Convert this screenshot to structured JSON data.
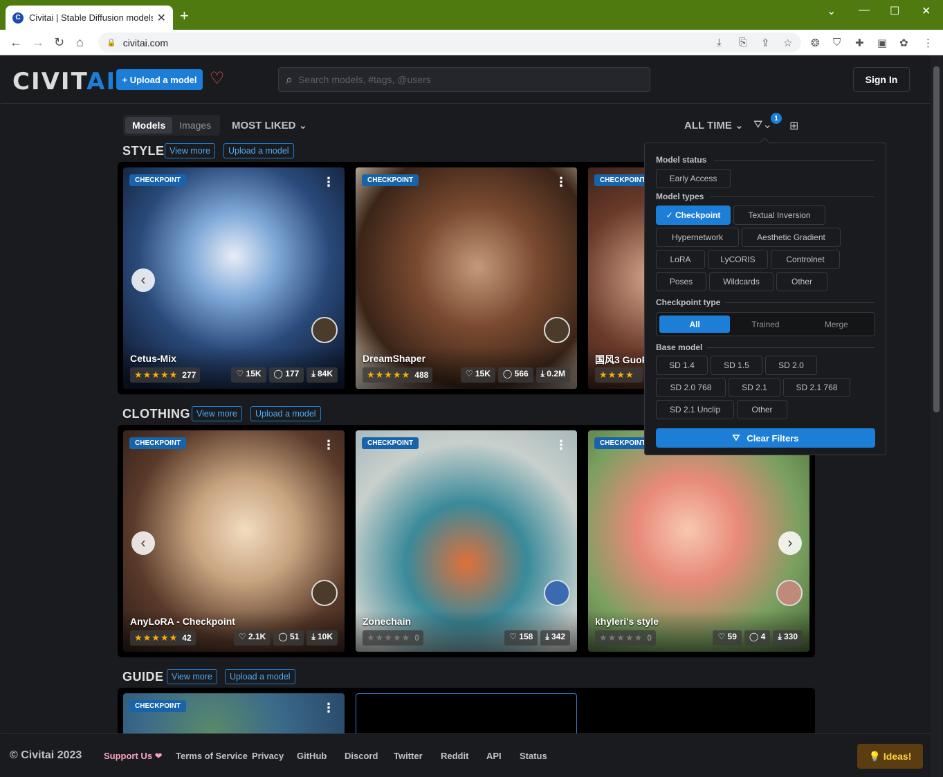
{
  "browser": {
    "tab_title": "Civitai | Stable Diffusion models",
    "url": "civitai.com",
    "favicon_letter": "C"
  },
  "header": {
    "logo_a": "CIVIT",
    "logo_b": "AI",
    "upload_label": "+ Upload a model",
    "search_placeholder": "Search models, #tags, @users",
    "signin_label": "Sign In"
  },
  "toolbar": {
    "tabs": [
      "Models",
      "Images"
    ],
    "active_tab": "Models",
    "sort_label": "MOST LIKED",
    "period_label": "ALL TIME",
    "filter_count": "1"
  },
  "sections": [
    {
      "title": "STYLE",
      "view_more": "View more",
      "upload": "Upload a model",
      "cards": [
        {
          "tag": "CHECKPOINT",
          "name": "Cetus-Mix",
          "stars": "★★★★★",
          "rating_count": "277",
          "likes": "♡ 15K",
          "comments": "◯ 177",
          "downloads": "⤓ 84K"
        },
        {
          "tag": "CHECKPOINT",
          "name": "DreamShaper",
          "stars": "★★★★★",
          "rating_count": "488",
          "likes": "♡ 15K",
          "comments": "◯ 566",
          "downloads": "⤓ 0.2M"
        },
        {
          "tag": "CHECKPOINT",
          "name": "国风3 GuoF",
          "stars": "★★★★",
          "rating_count": "",
          "likes": "",
          "comments": "",
          "downloads": ""
        }
      ]
    },
    {
      "title": "CLOTHING",
      "view_more": "View more",
      "upload": "Upload a model",
      "cards": [
        {
          "tag": "CHECKPOINT",
          "name": "AnyLoRA - Checkpoint",
          "stars": "★★★★★",
          "rating_count": "42",
          "likes": "♡ 2.1K",
          "comments": "◯ 51",
          "downloads": "⤓ 10K"
        },
        {
          "tag": "CHECKPOINT",
          "name": "Zonechain",
          "stars": "★★★★★",
          "rating_count": "0",
          "likes": "♡ 158",
          "comments": "",
          "downloads": "⤓ 342"
        },
        {
          "tag": "CHECKPOINT",
          "name": "khyleri's style",
          "stars": "★★★★★",
          "rating_count": "0",
          "likes": "♡ 59",
          "comments": "◯ 4",
          "downloads": "⤓ 330"
        }
      ]
    },
    {
      "title": "GUIDE",
      "view_more": "View more",
      "upload": "Upload a model",
      "cards": [
        {
          "tag": "CHECKPOINT"
        }
      ]
    }
  ],
  "filters": {
    "model_status_label": "Model status",
    "model_status": [
      "Early Access"
    ],
    "model_types_label": "Model types",
    "model_types": [
      "✓ Checkpoint",
      "Textual Inversion",
      "Hypernetwork",
      "Aesthetic Gradient",
      "LoRA",
      "LyCORIS",
      "Controlnet",
      "Poses",
      "Wildcards",
      "Other"
    ],
    "checkpoint_type_label": "Checkpoint type",
    "checkpoint_types": [
      "All",
      "Trained",
      "Merge"
    ],
    "base_model_label": "Base model",
    "base_models": [
      "SD 1.4",
      "SD 1.5",
      "SD 2.0",
      "SD 2.0 768",
      "SD 2.1",
      "SD 2.1 768",
      "SD 2.1 Unclip",
      "Other"
    ],
    "clear_label": "Clear Filters"
  },
  "footer": {
    "copyright": "© Civitai 2023",
    "support": "Support Us ❤",
    "links": [
      "Terms of Service",
      "Privacy",
      "GitHub",
      "Discord",
      "Twitter",
      "Reddit",
      "API",
      "Status"
    ],
    "ideas": "💡 Ideas!"
  }
}
